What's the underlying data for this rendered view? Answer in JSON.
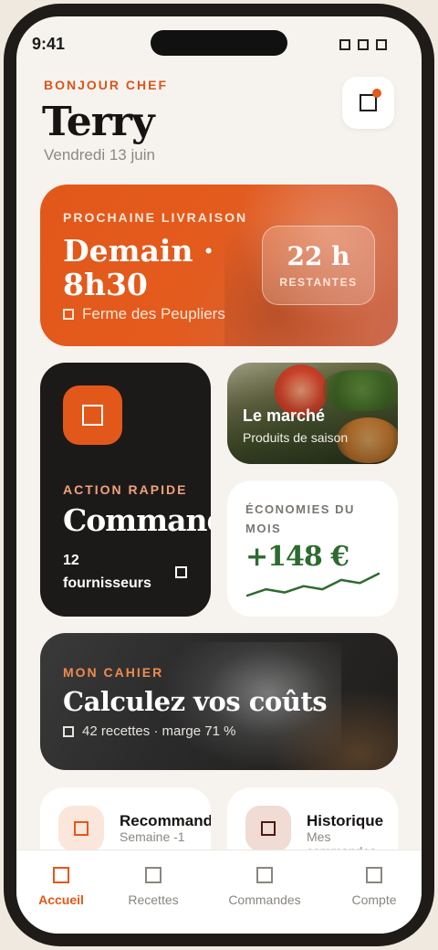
{
  "status_bar": {
    "time": "9:41"
  },
  "header": {
    "greeting": "BONJOUR CHEF",
    "name": "Terry",
    "date": "Vendredi 13 juin",
    "notification_icon": "bell-icon",
    "has_notification": true
  },
  "delivery": {
    "label": "PROCHAINE LIVRAISON",
    "when": "Demain · 8h30",
    "farm": "Ferme des Peupliers",
    "countdown_value": "22 h",
    "countdown_unit": "RESTANTES",
    "accent": "#e2581a"
  },
  "quick_action": {
    "label": "ACTION RAPIDE",
    "title": "Commander",
    "suppliers": "12 fournisseurs",
    "icon": "cart-icon"
  },
  "market": {
    "title": "Le marché",
    "subtitle": "Produits de saison"
  },
  "savings": {
    "label": "ÉCONOMIES DU MOIS",
    "value": "+148 €",
    "color": "#2d6b2e",
    "trend": [
      3,
      5,
      4,
      6,
      5,
      8,
      7,
      10
    ]
  },
  "notebook": {
    "label": "MON CAHIER",
    "title": "Calculez vos coûts",
    "meta": "42 recettes · marge 71 %"
  },
  "mini_cards": [
    {
      "title": "Recommander",
      "subtitle": "Semaine -1",
      "icon": "repeat-icon"
    },
    {
      "title": "Historique",
      "subtitle": "Mes commandes",
      "icon": "history-icon"
    }
  ],
  "tabs": [
    {
      "label": "Accueil",
      "icon": "home-icon",
      "active": true
    },
    {
      "label": "Recettes",
      "icon": "book-icon",
      "active": false
    },
    {
      "label": "Commandes",
      "icon": "bag-icon",
      "active": false
    },
    {
      "label": "Compte",
      "icon": "user-icon",
      "active": false
    }
  ]
}
